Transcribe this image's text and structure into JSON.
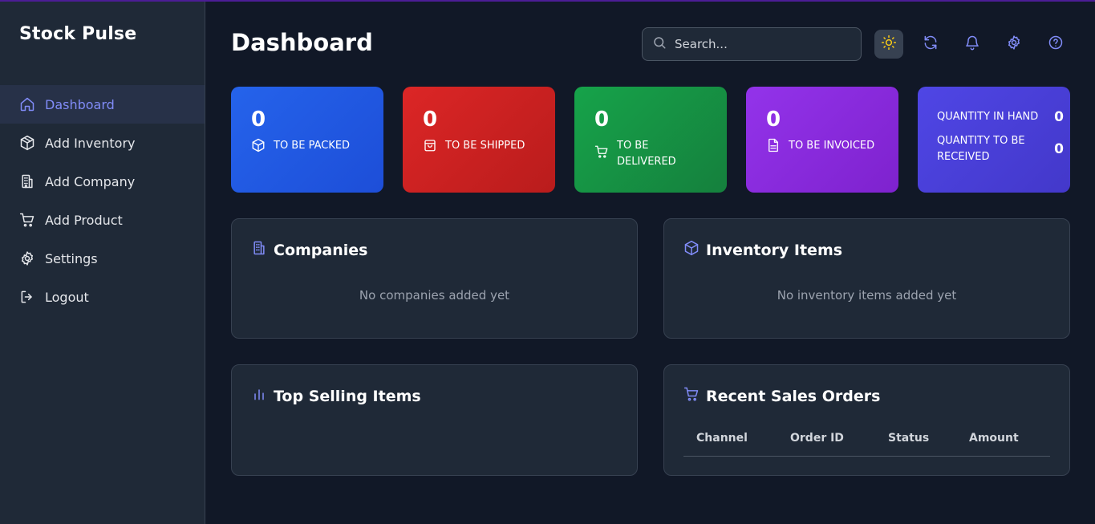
{
  "app": {
    "name": "Stock Pulse"
  },
  "sidebar": {
    "items": [
      {
        "label": "Dashboard",
        "icon": "home-icon",
        "active": true
      },
      {
        "label": "Add Inventory",
        "icon": "box-icon"
      },
      {
        "label": "Add Company",
        "icon": "building-icon"
      },
      {
        "label": "Add Product",
        "icon": "cart-icon"
      },
      {
        "label": "Settings",
        "icon": "gear-icon"
      },
      {
        "label": "Logout",
        "icon": "logout-icon"
      }
    ]
  },
  "header": {
    "title": "Dashboard",
    "search_placeholder": "Search...",
    "actions": [
      "sun-icon",
      "refresh-icon",
      "bell-icon",
      "gear-icon",
      "help-icon"
    ]
  },
  "stats": [
    {
      "value": "0",
      "label": "TO BE PACKED",
      "icon": "box-icon",
      "color": "#2563eb"
    },
    {
      "value": "0",
      "label": "TO BE SHIPPED",
      "icon": "bag-icon",
      "color": "#dc2626"
    },
    {
      "value": "0",
      "label": "TO BE DELIVERED",
      "icon": "cart-icon",
      "color": "#16a34a"
    },
    {
      "value": "0",
      "label": "TO BE INVOICED",
      "icon": "document-icon",
      "color": "#9333ea"
    }
  ],
  "quantity": {
    "in_hand_label": "QUANTITY IN HAND",
    "in_hand_value": "0",
    "to_receive_label": "QUANTITY TO BE RECEIVED",
    "to_receive_value": "0",
    "color": "#4f46e5"
  },
  "panels": {
    "companies": {
      "title": "Companies",
      "empty": "No companies added yet"
    },
    "inventory": {
      "title": "Inventory Items",
      "empty": "No inventory items added yet"
    },
    "top_selling": {
      "title": "Top Selling Items"
    },
    "recent_orders": {
      "title": "Recent Sales Orders",
      "columns": [
        "Channel",
        "Order ID",
        "Status",
        "Amount"
      ]
    }
  },
  "colors": {
    "accent": "#818cf8",
    "background": "#111827",
    "surface": "#1f2937"
  }
}
